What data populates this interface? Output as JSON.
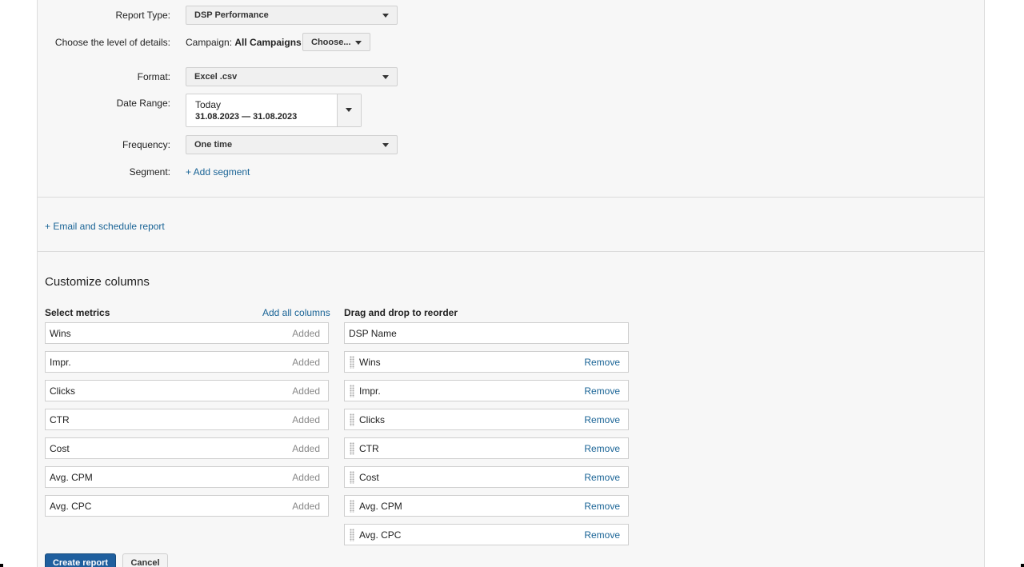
{
  "form": {
    "report_type": {
      "label": "Report Type:",
      "value": "DSP Performance"
    },
    "level": {
      "label": "Choose the level of details:",
      "prefix": "Campaign:",
      "value": "All Campaigns",
      "button": "Choose..."
    },
    "format": {
      "label": "Format:",
      "value": "Excel .csv"
    },
    "date_range": {
      "label": "Date Range:",
      "preset": "Today",
      "range": "31.08.2023 — 31.08.2023"
    },
    "frequency": {
      "label": "Frequency:",
      "value": "One time"
    },
    "segment": {
      "label": "Segment:",
      "link": "+ Add segment"
    }
  },
  "schedule": {
    "link": "+ Email and schedule report"
  },
  "customize": {
    "title": "Customize columns",
    "select_metrics": "Select metrics",
    "add_all": "Add all columns",
    "reorder": "Drag and drop to reorder",
    "added_label": "Added",
    "remove_label": "Remove",
    "fixed_column": "DSP Name",
    "metrics": [
      "Wins",
      "Impr.",
      "Clicks",
      "CTR",
      "Cost",
      "Avg. CPM",
      "Avg. CPC"
    ],
    "selected": [
      "Wins",
      "Impr.",
      "Clicks",
      "CTR",
      "Cost",
      "Avg. CPM",
      "Avg. CPC"
    ]
  },
  "actions": {
    "create": "Create report",
    "cancel": "Cancel"
  }
}
